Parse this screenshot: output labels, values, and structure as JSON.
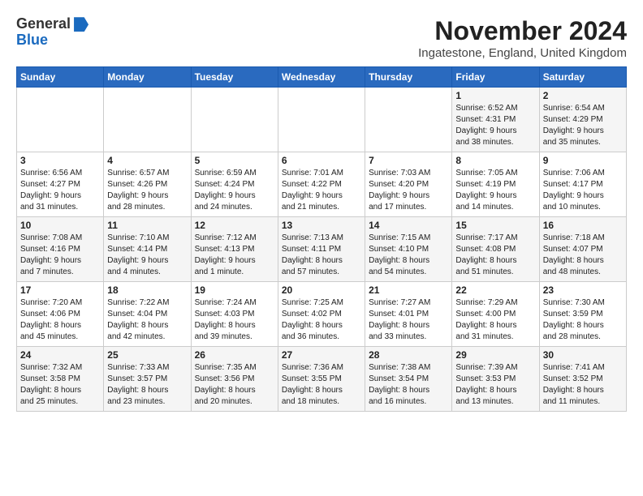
{
  "header": {
    "logo_general": "General",
    "logo_blue": "Blue",
    "month_title": "November 2024",
    "location": "Ingatestone, England, United Kingdom"
  },
  "weekdays": [
    "Sunday",
    "Monday",
    "Tuesday",
    "Wednesday",
    "Thursday",
    "Friday",
    "Saturday"
  ],
  "weeks": [
    [
      {
        "day": "",
        "info": ""
      },
      {
        "day": "",
        "info": ""
      },
      {
        "day": "",
        "info": ""
      },
      {
        "day": "",
        "info": ""
      },
      {
        "day": "",
        "info": ""
      },
      {
        "day": "1",
        "info": "Sunrise: 6:52 AM\nSunset: 4:31 PM\nDaylight: 9 hours\nand 38 minutes."
      },
      {
        "day": "2",
        "info": "Sunrise: 6:54 AM\nSunset: 4:29 PM\nDaylight: 9 hours\nand 35 minutes."
      }
    ],
    [
      {
        "day": "3",
        "info": "Sunrise: 6:56 AM\nSunset: 4:27 PM\nDaylight: 9 hours\nand 31 minutes."
      },
      {
        "day": "4",
        "info": "Sunrise: 6:57 AM\nSunset: 4:26 PM\nDaylight: 9 hours\nand 28 minutes."
      },
      {
        "day": "5",
        "info": "Sunrise: 6:59 AM\nSunset: 4:24 PM\nDaylight: 9 hours\nand 24 minutes."
      },
      {
        "day": "6",
        "info": "Sunrise: 7:01 AM\nSunset: 4:22 PM\nDaylight: 9 hours\nand 21 minutes."
      },
      {
        "day": "7",
        "info": "Sunrise: 7:03 AM\nSunset: 4:20 PM\nDaylight: 9 hours\nand 17 minutes."
      },
      {
        "day": "8",
        "info": "Sunrise: 7:05 AM\nSunset: 4:19 PM\nDaylight: 9 hours\nand 14 minutes."
      },
      {
        "day": "9",
        "info": "Sunrise: 7:06 AM\nSunset: 4:17 PM\nDaylight: 9 hours\nand 10 minutes."
      }
    ],
    [
      {
        "day": "10",
        "info": "Sunrise: 7:08 AM\nSunset: 4:16 PM\nDaylight: 9 hours\nand 7 minutes."
      },
      {
        "day": "11",
        "info": "Sunrise: 7:10 AM\nSunset: 4:14 PM\nDaylight: 9 hours\nand 4 minutes."
      },
      {
        "day": "12",
        "info": "Sunrise: 7:12 AM\nSunset: 4:13 PM\nDaylight: 9 hours\nand 1 minute."
      },
      {
        "day": "13",
        "info": "Sunrise: 7:13 AM\nSunset: 4:11 PM\nDaylight: 8 hours\nand 57 minutes."
      },
      {
        "day": "14",
        "info": "Sunrise: 7:15 AM\nSunset: 4:10 PM\nDaylight: 8 hours\nand 54 minutes."
      },
      {
        "day": "15",
        "info": "Sunrise: 7:17 AM\nSunset: 4:08 PM\nDaylight: 8 hours\nand 51 minutes."
      },
      {
        "day": "16",
        "info": "Sunrise: 7:18 AM\nSunset: 4:07 PM\nDaylight: 8 hours\nand 48 minutes."
      }
    ],
    [
      {
        "day": "17",
        "info": "Sunrise: 7:20 AM\nSunset: 4:06 PM\nDaylight: 8 hours\nand 45 minutes."
      },
      {
        "day": "18",
        "info": "Sunrise: 7:22 AM\nSunset: 4:04 PM\nDaylight: 8 hours\nand 42 minutes."
      },
      {
        "day": "19",
        "info": "Sunrise: 7:24 AM\nSunset: 4:03 PM\nDaylight: 8 hours\nand 39 minutes."
      },
      {
        "day": "20",
        "info": "Sunrise: 7:25 AM\nSunset: 4:02 PM\nDaylight: 8 hours\nand 36 minutes."
      },
      {
        "day": "21",
        "info": "Sunrise: 7:27 AM\nSunset: 4:01 PM\nDaylight: 8 hours\nand 33 minutes."
      },
      {
        "day": "22",
        "info": "Sunrise: 7:29 AM\nSunset: 4:00 PM\nDaylight: 8 hours\nand 31 minutes."
      },
      {
        "day": "23",
        "info": "Sunrise: 7:30 AM\nSunset: 3:59 PM\nDaylight: 8 hours\nand 28 minutes."
      }
    ],
    [
      {
        "day": "24",
        "info": "Sunrise: 7:32 AM\nSunset: 3:58 PM\nDaylight: 8 hours\nand 25 minutes."
      },
      {
        "day": "25",
        "info": "Sunrise: 7:33 AM\nSunset: 3:57 PM\nDaylight: 8 hours\nand 23 minutes."
      },
      {
        "day": "26",
        "info": "Sunrise: 7:35 AM\nSunset: 3:56 PM\nDaylight: 8 hours\nand 20 minutes."
      },
      {
        "day": "27",
        "info": "Sunrise: 7:36 AM\nSunset: 3:55 PM\nDaylight: 8 hours\nand 18 minutes."
      },
      {
        "day": "28",
        "info": "Sunrise: 7:38 AM\nSunset: 3:54 PM\nDaylight: 8 hours\nand 16 minutes."
      },
      {
        "day": "29",
        "info": "Sunrise: 7:39 AM\nSunset: 3:53 PM\nDaylight: 8 hours\nand 13 minutes."
      },
      {
        "day": "30",
        "info": "Sunrise: 7:41 AM\nSunset: 3:52 PM\nDaylight: 8 hours\nand 11 minutes."
      }
    ]
  ]
}
